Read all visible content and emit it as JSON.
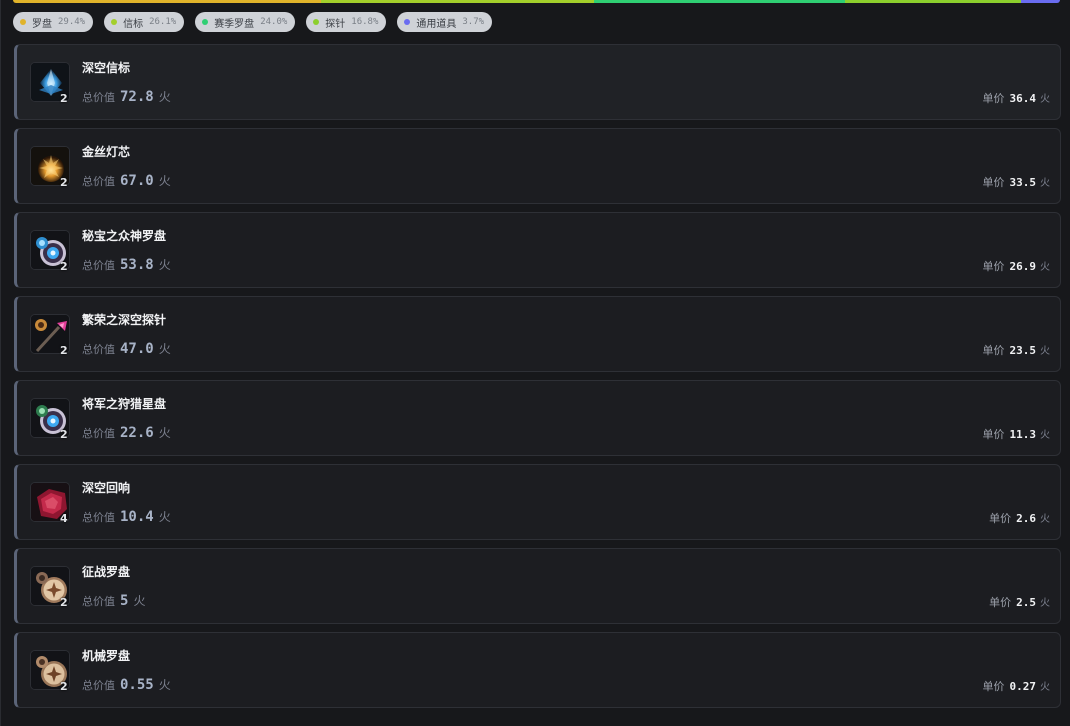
{
  "distribution": [
    {
      "name": "罗盘",
      "pct": "29.4%",
      "share": 29.4,
      "color": "#e0b32a"
    },
    {
      "name": "信标",
      "pct": "26.1%",
      "share": 26.1,
      "color": "#a3cf2b"
    },
    {
      "name": "赛季罗盘",
      "pct": "24.0%",
      "share": 24.0,
      "color": "#2fcf73"
    },
    {
      "name": "探针",
      "pct": "16.8%",
      "share": 16.8,
      "color": "#8ccf2d"
    },
    {
      "name": "通用道具",
      "pct": "3.7%",
      "share": 3.7,
      "color": "#6a6cf0"
    }
  ],
  "labels": {
    "total": "总价值",
    "unit": "单价",
    "currency": "火"
  },
  "items": [
    {
      "name": "深空信标",
      "qty": "2",
      "total": "72.8",
      "unit_price": "36.4",
      "icon": "crystal-beacon-icon"
    },
    {
      "name": "金丝灯芯",
      "qty": "2",
      "total": "67.0",
      "unit_price": "33.5",
      "icon": "golden-wick-icon"
    },
    {
      "name": "秘宝之众神罗盘",
      "qty": "2",
      "total": "53.8",
      "unit_price": "26.9",
      "icon": "pantheon-compass-icon"
    },
    {
      "name": "繁荣之深空探针",
      "qty": "2",
      "total": "47.0",
      "unit_price": "23.5",
      "icon": "deep-space-probe-icon"
    },
    {
      "name": "将军之狩猎星盘",
      "qty": "2",
      "total": "22.6",
      "unit_price": "11.3",
      "icon": "hunting-astrolabe-icon"
    },
    {
      "name": "深空回响",
      "qty": "4",
      "total": "10.4",
      "unit_price": "2.6",
      "icon": "deep-echo-icon"
    },
    {
      "name": "征战罗盘",
      "qty": "2",
      "total": "5",
      "unit_price": "2.5",
      "icon": "war-compass-icon"
    },
    {
      "name": "机械罗盘",
      "qty": "2",
      "total": "0.55",
      "unit_price": "0.27",
      "icon": "mechanical-compass-icon"
    }
  ]
}
